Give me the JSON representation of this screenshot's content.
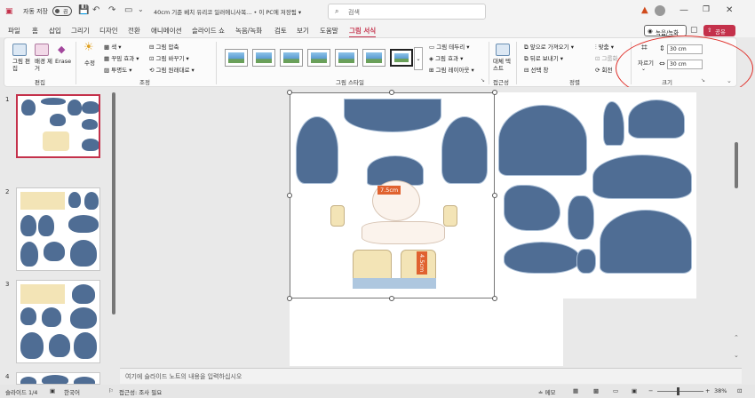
{
  "titlebar": {
    "autosave_label": "자동 저장",
    "autosave_state": "끔",
    "doc_title": "40cm 기준 베치 유리코 일러에니사복... • 이 PC에 저장됨 ▾",
    "search_placeholder": "검색"
  },
  "menu": [
    "파일",
    "홈",
    "삽입",
    "그리기",
    "디자인",
    "전환",
    "애니메이션",
    "슬라이드 쇼",
    "녹음/녹화",
    "검토",
    "보기",
    "도움말",
    "그림 서식"
  ],
  "menu_active": "그림 서식",
  "record_button": "녹음/녹화",
  "share_button": "공유",
  "ribbon": {
    "edit_group": {
      "buttons": [
        "그림 편집",
        "배경 제거",
        "Erase"
      ],
      "label": "편집"
    },
    "adjust_group": {
      "big_button": "수정",
      "items": [
        "색",
        "꾸밈 효과",
        "투명도",
        "그림 압축",
        "그림 바꾸기",
        "그림 원래대로"
      ],
      "label": "조정"
    },
    "styles_group": {
      "label": "그림 스타일",
      "thumb_count": 7
    },
    "style_options": [
      "그림 테두리",
      "그림 효과",
      "그림 레이아웃"
    ],
    "accessibility_group": {
      "button": "대체 텍스트",
      "label": "접근성"
    },
    "arrange_group": {
      "items": [
        "앞으로 가져오기",
        "뒤로 보내기",
        "선택 창",
        "맞춤",
        "그룹화",
        "회전"
      ],
      "label": "정렬"
    },
    "size_group": {
      "crop": "자르기",
      "height": "30 cm",
      "width": "30 cm",
      "label": "크기"
    }
  },
  "slides": [
    {
      "num": "1",
      "selected": true
    },
    {
      "num": "2",
      "selected": false
    },
    {
      "num": "3",
      "selected": false
    },
    {
      "num": "4",
      "selected": false
    }
  ],
  "canvas": {
    "label_width": "7.5cm",
    "label_height": "4.5cm"
  },
  "notes_placeholder": "여기에 슬라이드 노트의 내용을 입력하십시오",
  "status": {
    "slide_info": "슬라이드 1/4",
    "language": "한국어",
    "accessibility": "접근성: 조사 필요",
    "notes": "메모",
    "zoom": "38%"
  },
  "colors": {
    "accent": "#c4314b",
    "hair": "#4f6d94",
    "annotation": "#e0302a",
    "measure_label": "#e0622f"
  }
}
